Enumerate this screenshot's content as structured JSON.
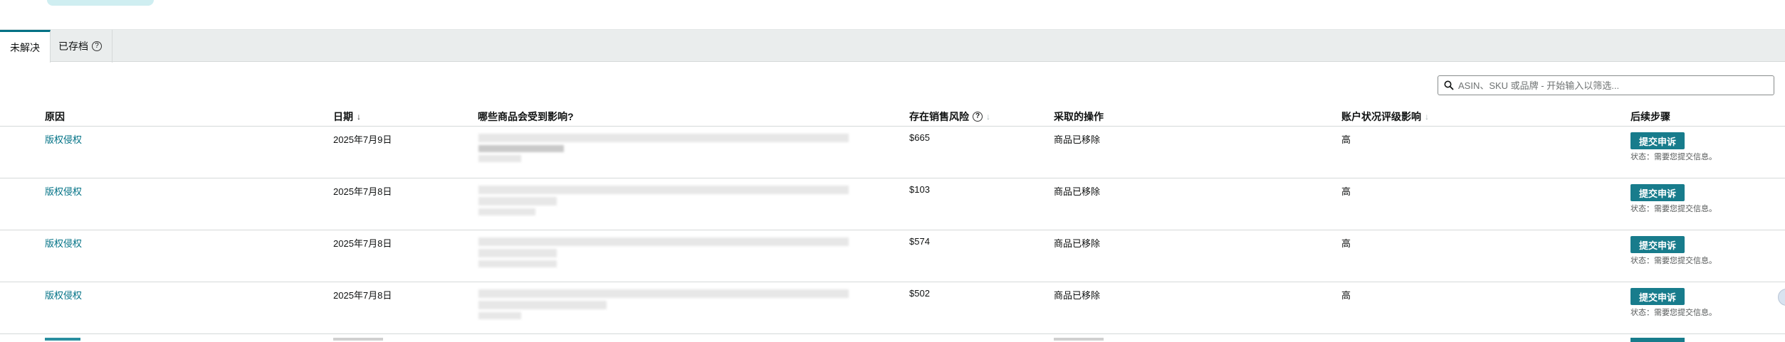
{
  "tabs": [
    {
      "label": "未解决",
      "active": true
    },
    {
      "label": "已存档",
      "active": false,
      "help_icon": "question-circle-icon"
    }
  ],
  "search": {
    "placeholder": "ASIN、SKU 或品牌 - 开始输入以筛选...",
    "icon": "search-icon"
  },
  "table": {
    "headers": {
      "reason": "原因",
      "date": "日期",
      "affected": "哪些商品会受到影响?",
      "risk": "存在销售风险",
      "action": "采取的操作",
      "health": "账户状况评级影响",
      "next": "后续步骤"
    },
    "rows": [
      {
        "reason": "版权侵权",
        "date": "2025年7月9日",
        "risk": "$665",
        "action": "商品已移除",
        "health": "高",
        "button": "提交申诉",
        "status": "状态：需要您提交信息。"
      },
      {
        "reason": "版权侵权",
        "date": "2025年7月8日",
        "risk": "$103",
        "action": "商品已移除",
        "health": "高",
        "button": "提交申诉",
        "status": "状态：需要您提交信息。"
      },
      {
        "reason": "版权侵权",
        "date": "2025年7月8日",
        "risk": "$574",
        "action": "商品已移除",
        "health": "高",
        "button": "提交申诉",
        "status": "状态：需要您提交信息。"
      },
      {
        "reason": "版权侵权",
        "date": "2025年7月8日",
        "risk": "$502",
        "action": "商品已移除",
        "health": "高",
        "button": "提交申诉",
        "status": "状态：需要您提交信息。"
      }
    ]
  },
  "colors": {
    "accent": "#007185",
    "button": "#187c8c",
    "tabs_bg": "#eaeded"
  }
}
